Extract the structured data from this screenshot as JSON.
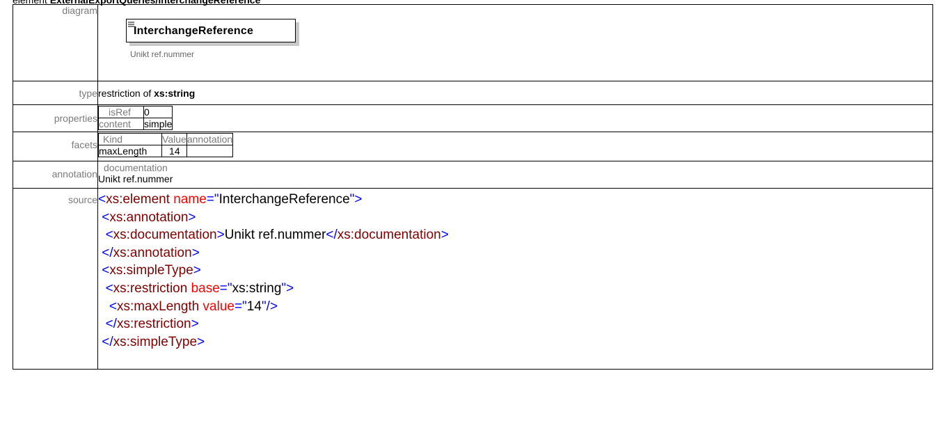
{
  "heading": {
    "prefix": "element ",
    "path_bold": "ExternalExportQueries/InterchangeReference"
  },
  "rows": {
    "diagram_label": "diagram",
    "type_label": "type",
    "properties_label": "properties",
    "facets_label": "facets",
    "annotation_label": "annotation",
    "source_label": "source"
  },
  "diagram": {
    "element_name": "InterchangeReference",
    "documentation": "Unikt ref.nummer"
  },
  "type": {
    "prefix": "restriction of ",
    "base": "xs:string"
  },
  "properties": {
    "items": [
      {
        "key": "isRef",
        "value": "0"
      },
      {
        "key": "content",
        "value": "simple"
      }
    ]
  },
  "facets": {
    "headers": [
      "Kind",
      "Value",
      "annotation"
    ],
    "rows": [
      {
        "kind": "maxLength",
        "value": "14",
        "annotation": ""
      }
    ]
  },
  "annotation": {
    "title": "documentation",
    "text": "Unikt ref.nummer"
  },
  "source": {
    "lines": [
      {
        "indent": "",
        "parts": [
          [
            "punc",
            "<"
          ],
          [
            "tag",
            "xs:element"
          ],
          [
            "txt",
            " "
          ],
          [
            "attr",
            "name"
          ],
          [
            "punc",
            "=\""
          ],
          [
            "val",
            "InterchangeReference"
          ],
          [
            "punc",
            "\">"
          ]
        ]
      },
      {
        "indent": " ",
        "parts": [
          [
            "punc",
            "<"
          ],
          [
            "tag",
            "xs:annotation"
          ],
          [
            "punc",
            ">"
          ]
        ]
      },
      {
        "indent": "  ",
        "parts": [
          [
            "punc",
            "<"
          ],
          [
            "tag",
            "xs:documentation"
          ],
          [
            "punc",
            ">"
          ],
          [
            "txt",
            "Unikt ref.nummer"
          ],
          [
            "punc",
            "</"
          ],
          [
            "tag",
            "xs:documentation"
          ],
          [
            "punc",
            ">"
          ]
        ]
      },
      {
        "indent": " ",
        "parts": [
          [
            "punc",
            "</"
          ],
          [
            "tag",
            "xs:annotation"
          ],
          [
            "punc",
            ">"
          ]
        ]
      },
      {
        "indent": " ",
        "parts": [
          [
            "punc",
            "<"
          ],
          [
            "tag",
            "xs:simpleType"
          ],
          [
            "punc",
            ">"
          ]
        ]
      },
      {
        "indent": "  ",
        "parts": [
          [
            "punc",
            "<"
          ],
          [
            "tag",
            "xs:restriction"
          ],
          [
            "txt",
            " "
          ],
          [
            "attr",
            "base"
          ],
          [
            "punc",
            "=\""
          ],
          [
            "val",
            "xs:string"
          ],
          [
            "punc",
            "\">"
          ]
        ]
      },
      {
        "indent": "   ",
        "parts": [
          [
            "punc",
            "<"
          ],
          [
            "tag",
            "xs:maxLength"
          ],
          [
            "txt",
            " "
          ],
          [
            "attr",
            "value"
          ],
          [
            "punc",
            "=\""
          ],
          [
            "val",
            "14"
          ],
          [
            "punc",
            "\"/>"
          ]
        ]
      },
      {
        "indent": "  ",
        "parts": [
          [
            "punc",
            "</"
          ],
          [
            "tag",
            "xs:restriction"
          ],
          [
            "punc",
            ">"
          ]
        ]
      },
      {
        "indent": " ",
        "parts": [
          [
            "punc",
            "</"
          ],
          [
            "tag",
            "xs:simpleType"
          ],
          [
            "punc",
            ">"
          ]
        ]
      }
    ]
  }
}
